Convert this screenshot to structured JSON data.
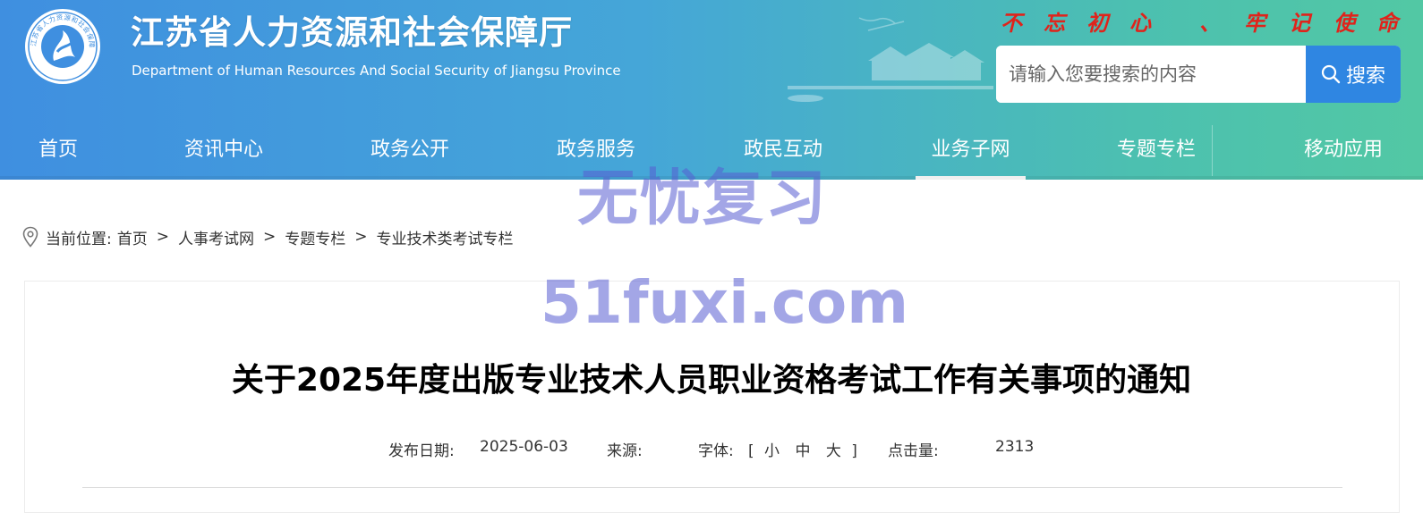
{
  "header": {
    "title": "江苏省人力资源和社会保障厅",
    "subtitle": "Department of Human Resources And Social Security of Jiangsu Province",
    "emblem_text": "江苏省人力资源和社会保障厅",
    "slogan_chars": [
      "不",
      "忘",
      "初",
      "心",
      "、",
      "牢",
      "记",
      "使",
      "命"
    ],
    "slogan_color": "#e0231b",
    "gradient_colors": [
      "#3f8fe0",
      "#45a6d8",
      "#4cc0b0",
      "#52c8a4"
    ]
  },
  "search": {
    "placeholder": "请输入您要搜索的内容",
    "button_label": "搜索",
    "button_icon": "search-icon",
    "button_color": "#2f86e2"
  },
  "nav": {
    "items": [
      {
        "label": "首页"
      },
      {
        "label": "资讯中心"
      },
      {
        "label": "政务公开"
      },
      {
        "label": "政务服务"
      },
      {
        "label": "政民互动"
      },
      {
        "label": "业务子网",
        "active": true
      },
      {
        "label": "专题专栏"
      },
      {
        "label": "移动应用"
      }
    ]
  },
  "breadcrumb": {
    "icon": "location-pin-icon",
    "prefix": "当前位置:",
    "items": [
      "首页",
      "人事考试网",
      "专题专栏",
      "专业技术类考试专栏"
    ],
    "separator": ">"
  },
  "article": {
    "title": "关于2025年度出版专业技术人员职业资格考试工作有关事项的通知",
    "date_label": "发布日期:",
    "date_value": "2025-06-03",
    "source_label": "来源:",
    "source_value": "",
    "font_label": "字体:",
    "font_open": "[",
    "font_small": "小",
    "font_medium": "中",
    "font_large": "大",
    "font_close": "]",
    "views_label": "点击量:",
    "views_value": "2313"
  },
  "watermark": {
    "line1": "无忧复习",
    "line2": "51fuxi.com",
    "color": "#585cd2"
  }
}
